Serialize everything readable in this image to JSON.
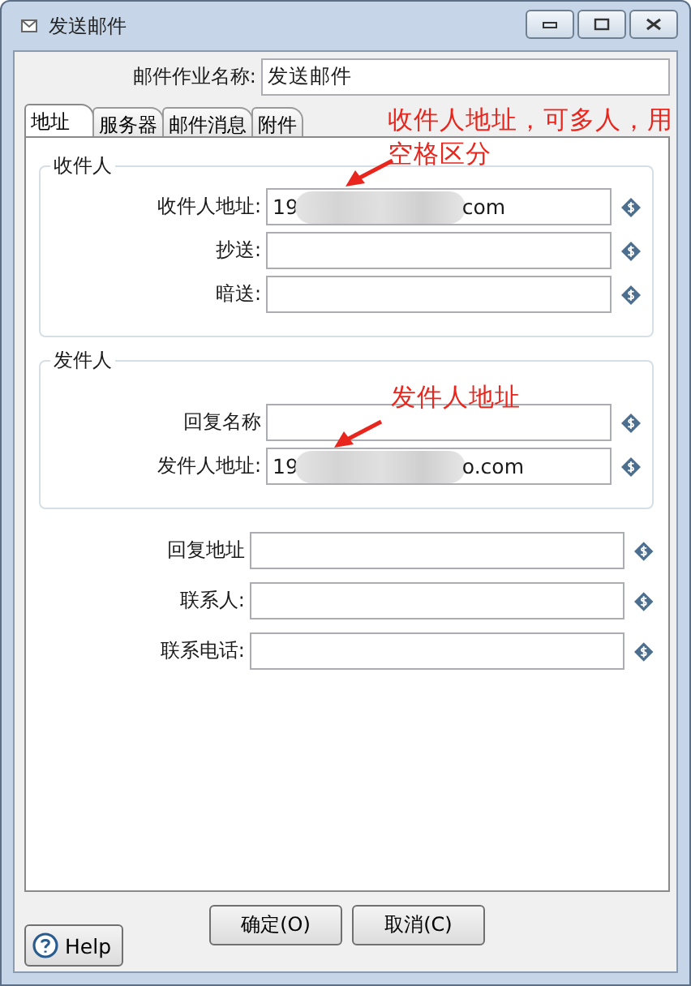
{
  "window": {
    "title": "发送邮件"
  },
  "job_name": {
    "label": "邮件作业名称:",
    "value": "发送邮件"
  },
  "tabs": [
    {
      "label": "地址",
      "selected": true
    },
    {
      "label": "服务器",
      "selected": false
    },
    {
      "label": "邮件消息",
      "selected": false
    },
    {
      "label": "附件",
      "selected": false
    }
  ],
  "groups": [
    {
      "title": "收件人",
      "fields": [
        {
          "label": "收件人地址:",
          "value_start": "19",
          "value_end": "com",
          "blurred": true
        },
        {
          "label": "抄送:"
        },
        {
          "label": "暗送:"
        }
      ]
    },
    {
      "title": "发件人",
      "fields": [
        {
          "label": "回复名称"
        },
        {
          "label": "发件人地址:",
          "value_start": "19",
          "value_end": "o.com",
          "blurred": true
        }
      ]
    }
  ],
  "fields": [
    {
      "label": "回复地址"
    },
    {
      "label": "联系人:"
    },
    {
      "label": "联系电话:"
    }
  ],
  "buttons": [
    {
      "label": "确定(O)"
    },
    {
      "label": "取消(C)"
    }
  ],
  "help": {
    "label": "Help"
  },
  "annotations": [
    {
      "text": "收件人地址，可多人，用",
      "line2": "空格区分",
      "kind": "note-recipient"
    },
    {
      "text": "发件人地址",
      "kind": "note-sender"
    }
  ]
}
